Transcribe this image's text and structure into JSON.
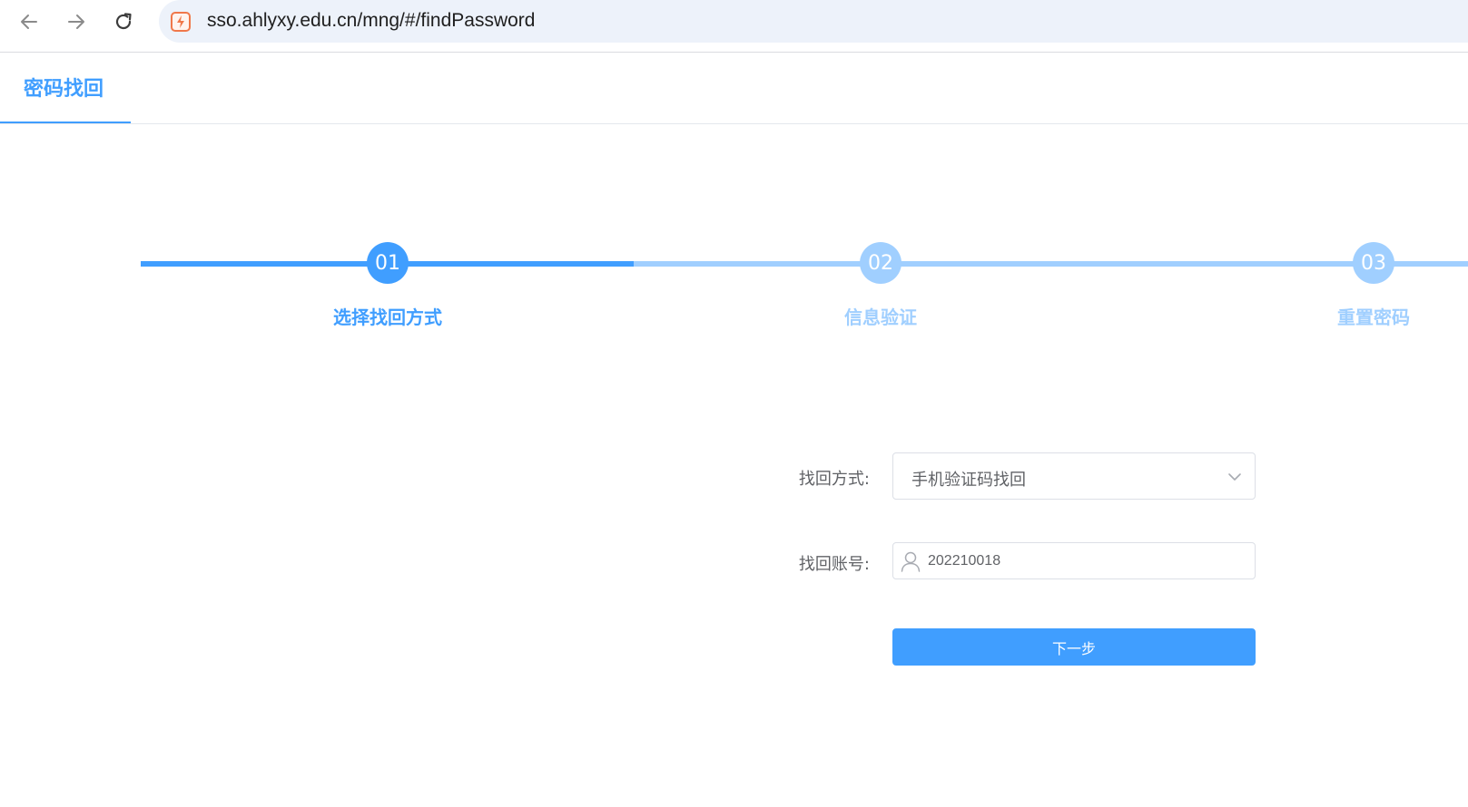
{
  "browser": {
    "url": "sso.ahlyxy.edu.cn/mng/#/findPassword",
    "icons": [
      "back-icon",
      "forward-icon",
      "reload-icon",
      "site-icon"
    ]
  },
  "tabs": {
    "active_label": "密码找回"
  },
  "steps": {
    "items": [
      {
        "number": "01",
        "label": "选择找回方式",
        "state": "active"
      },
      {
        "number": "02",
        "label": "信息验证",
        "state": "pending"
      },
      {
        "number": "03",
        "label": "重置密码",
        "state": "pending"
      }
    ]
  },
  "form": {
    "method_label": "找回方式:",
    "method_value": "手机验证码找回",
    "account_label": "找回账号:",
    "account_value": "202210018",
    "next_label": "下一步"
  },
  "colors": {
    "primary": "#409eff",
    "primary_light": "#a0cfff",
    "text": "#606266",
    "border": "#dcdfe6"
  }
}
